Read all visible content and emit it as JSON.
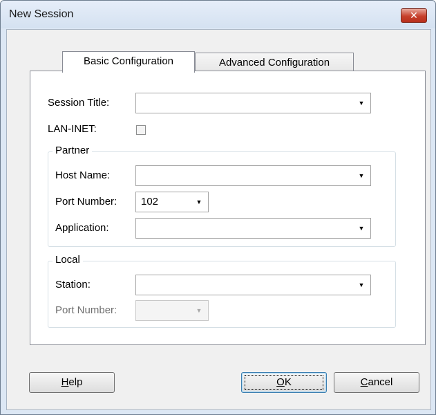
{
  "window": {
    "title": "New Session",
    "close_glyph": "✕"
  },
  "tabs": [
    {
      "label": "Basic Configuration",
      "active": true
    },
    {
      "label": "Advanced Configuration",
      "active": false
    }
  ],
  "form": {
    "session_title": {
      "label": "Session Title:",
      "value": ""
    },
    "lan_inet": {
      "label": "LAN-INET:",
      "checked": false
    },
    "partner": {
      "title": "Partner",
      "host_name": {
        "label": "Host Name:",
        "value": ""
      },
      "port_number": {
        "label": "Port Number:",
        "value": "102"
      },
      "application": {
        "label": "Application:",
        "value": ""
      }
    },
    "local": {
      "title": "Local",
      "station": {
        "label": "Station:",
        "value": ""
      },
      "port_number": {
        "label": "Port Number:",
        "value": "",
        "disabled": true
      }
    }
  },
  "buttons": {
    "help": {
      "mnemonic": "H",
      "rest": "elp"
    },
    "ok": {
      "mnemonic": "O",
      "rest": "K"
    },
    "cancel": {
      "mnemonic": "C",
      "rest": "ancel"
    }
  },
  "dropdown_arrow": "▼"
}
